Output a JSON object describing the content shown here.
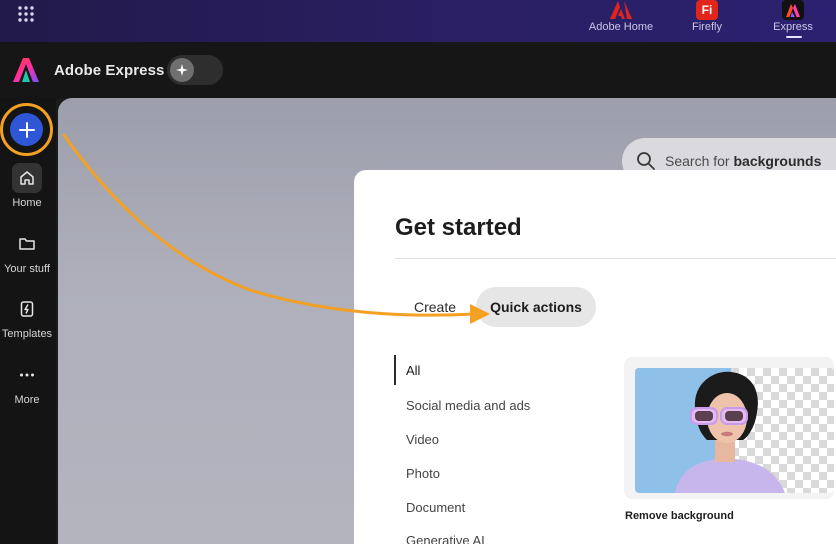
{
  "topbar": {
    "apps": [
      {
        "label": "Adobe Home",
        "icon": "adobe-icon"
      },
      {
        "label": "Firefly",
        "icon": "firefly-icon",
        "badge": "Fi"
      },
      {
        "label": "Express",
        "icon": "express-icon"
      }
    ],
    "active_app": "Express"
  },
  "header": {
    "brand": "Adobe Express"
  },
  "sidebar": {
    "create_button_icon": "plus-icon",
    "items": [
      {
        "label": "Home",
        "icon": "home-icon",
        "active": true
      },
      {
        "label": "Your stuff",
        "icon": "folder-icon"
      },
      {
        "label": "Templates",
        "icon": "templates-icon"
      },
      {
        "label": "More",
        "icon": "more-icon"
      }
    ]
  },
  "search": {
    "prefix": "Search for ",
    "keyword": "backgrounds"
  },
  "modal": {
    "title": "Get started",
    "tabs": [
      {
        "label": "Create"
      },
      {
        "label": "Quick actions",
        "selected": true
      }
    ],
    "categories": [
      "All",
      "Social media and ads",
      "Video",
      "Photo",
      "Document",
      "Generative AI"
    ],
    "selected_category": "All",
    "cards": [
      {
        "label": "Remove background"
      }
    ]
  },
  "colors": {
    "accent_blue": "#2f56d4",
    "highlight_orange": "#f4a023",
    "adobe_red": "#e1251b"
  }
}
